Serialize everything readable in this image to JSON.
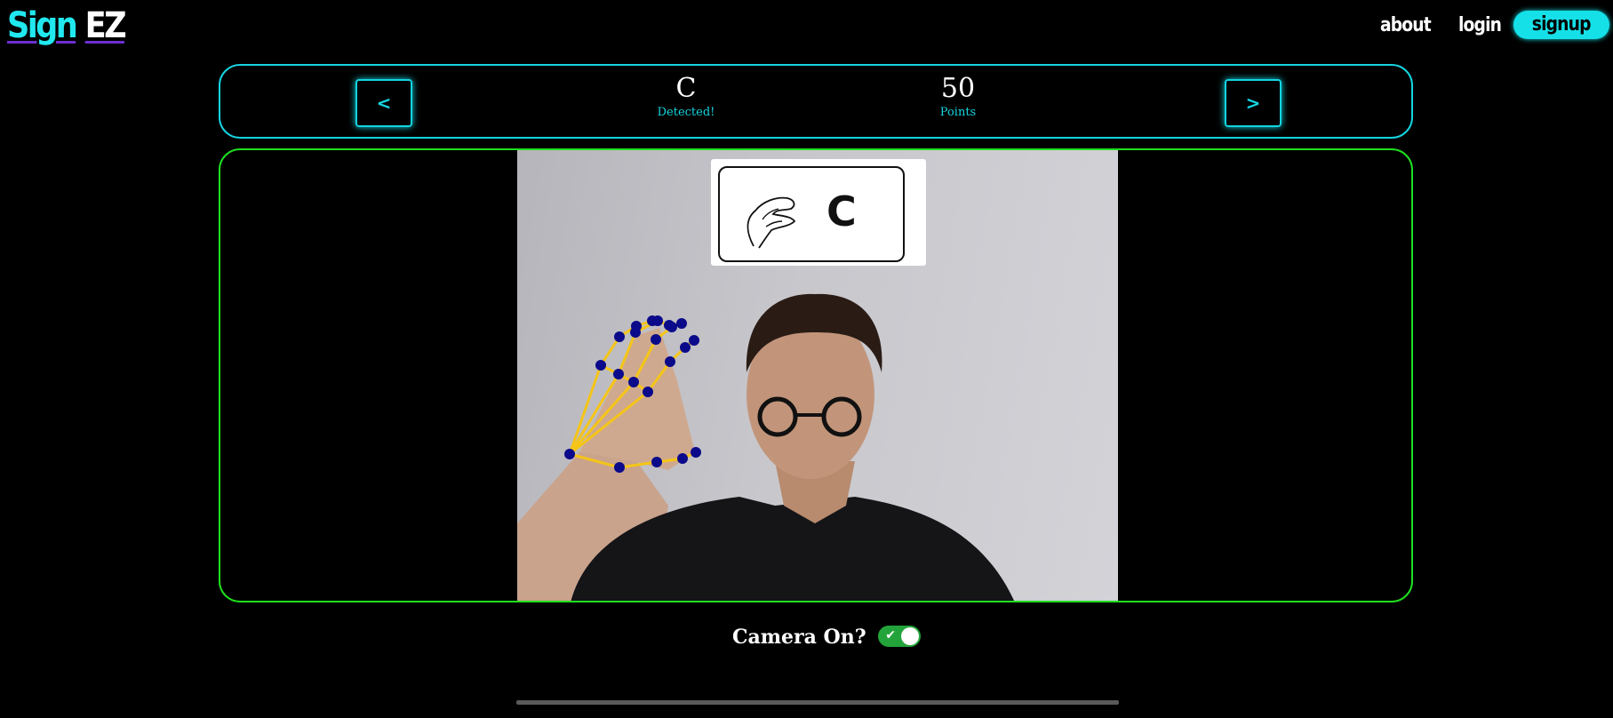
{
  "logo": {
    "part1": "Sign",
    "part2": "EZ"
  },
  "nav": {
    "about": "about",
    "login": "login",
    "signup": "signup"
  },
  "controls": {
    "prev_label": "<",
    "next_label": ">",
    "letter": "C",
    "letter_status": "Detected!",
    "points": "50",
    "points_label": "Points"
  },
  "camera": {
    "card_letter": "C",
    "toggle_label": "Camera On?",
    "toggle_on": true,
    "toggle_check": "✔"
  },
  "colors": {
    "accent_cyan": "#14d4e0",
    "panel_green": "#1ee01e",
    "landmark_line": "#f5c518",
    "landmark_point": "#0a0a8a",
    "switch_on": "#23a43a"
  },
  "icons": [
    "hand-sign-illustration",
    "check-icon"
  ]
}
